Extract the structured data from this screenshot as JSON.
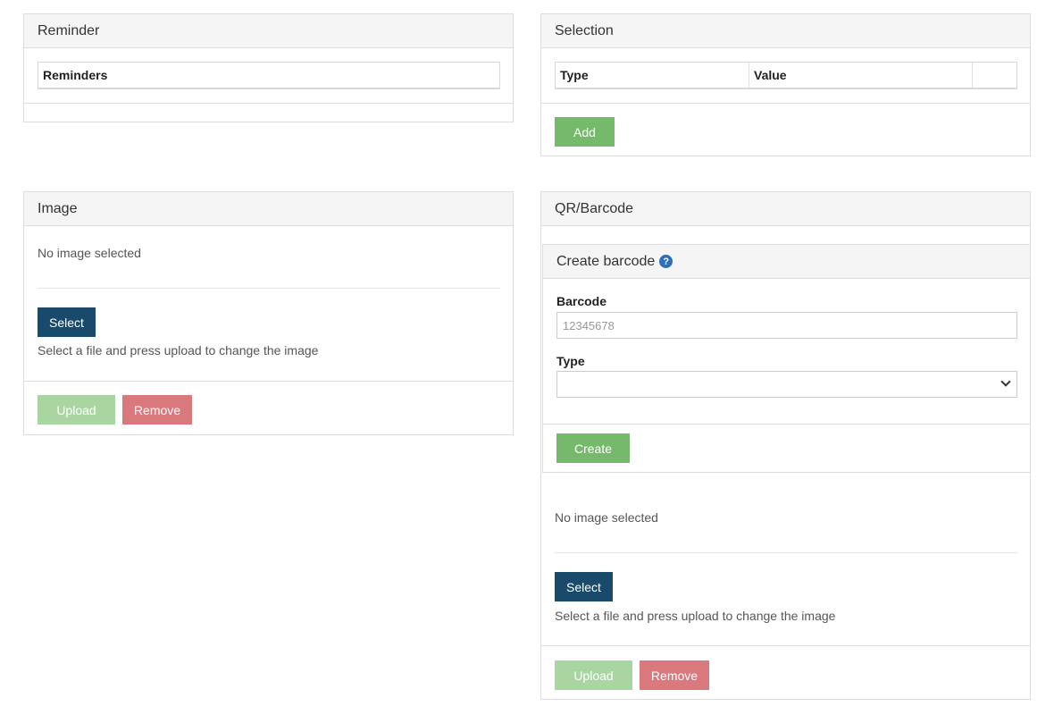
{
  "reminder": {
    "title": "Reminder",
    "table_header": "Reminders"
  },
  "selection": {
    "title": "Selection",
    "columns": [
      "Type",
      "Value",
      ""
    ],
    "add_label": "Add"
  },
  "image": {
    "title": "Image",
    "status": "No image selected",
    "select_label": "Select",
    "hint": "Select a file and press upload to change the image",
    "upload_label": "Upload",
    "remove_label": "Remove"
  },
  "qr": {
    "title": "QR/Barcode",
    "create_title": "Create barcode",
    "help_glyph": "?",
    "barcode_label": "Barcode",
    "barcode_placeholder": "12345678",
    "type_label": "Type",
    "type_value": "",
    "create_label": "Create",
    "status": "No image selected",
    "select_label": "Select",
    "hint": "Select a file and press upload to change the image",
    "upload_label": "Upload",
    "remove_label": "Remove"
  },
  "colors": {
    "success": "#75b96a",
    "success_disabled": "#a8d5a0",
    "danger": "#d9797e",
    "navy": "#1a4a6b",
    "help": "#2f6eb8"
  }
}
